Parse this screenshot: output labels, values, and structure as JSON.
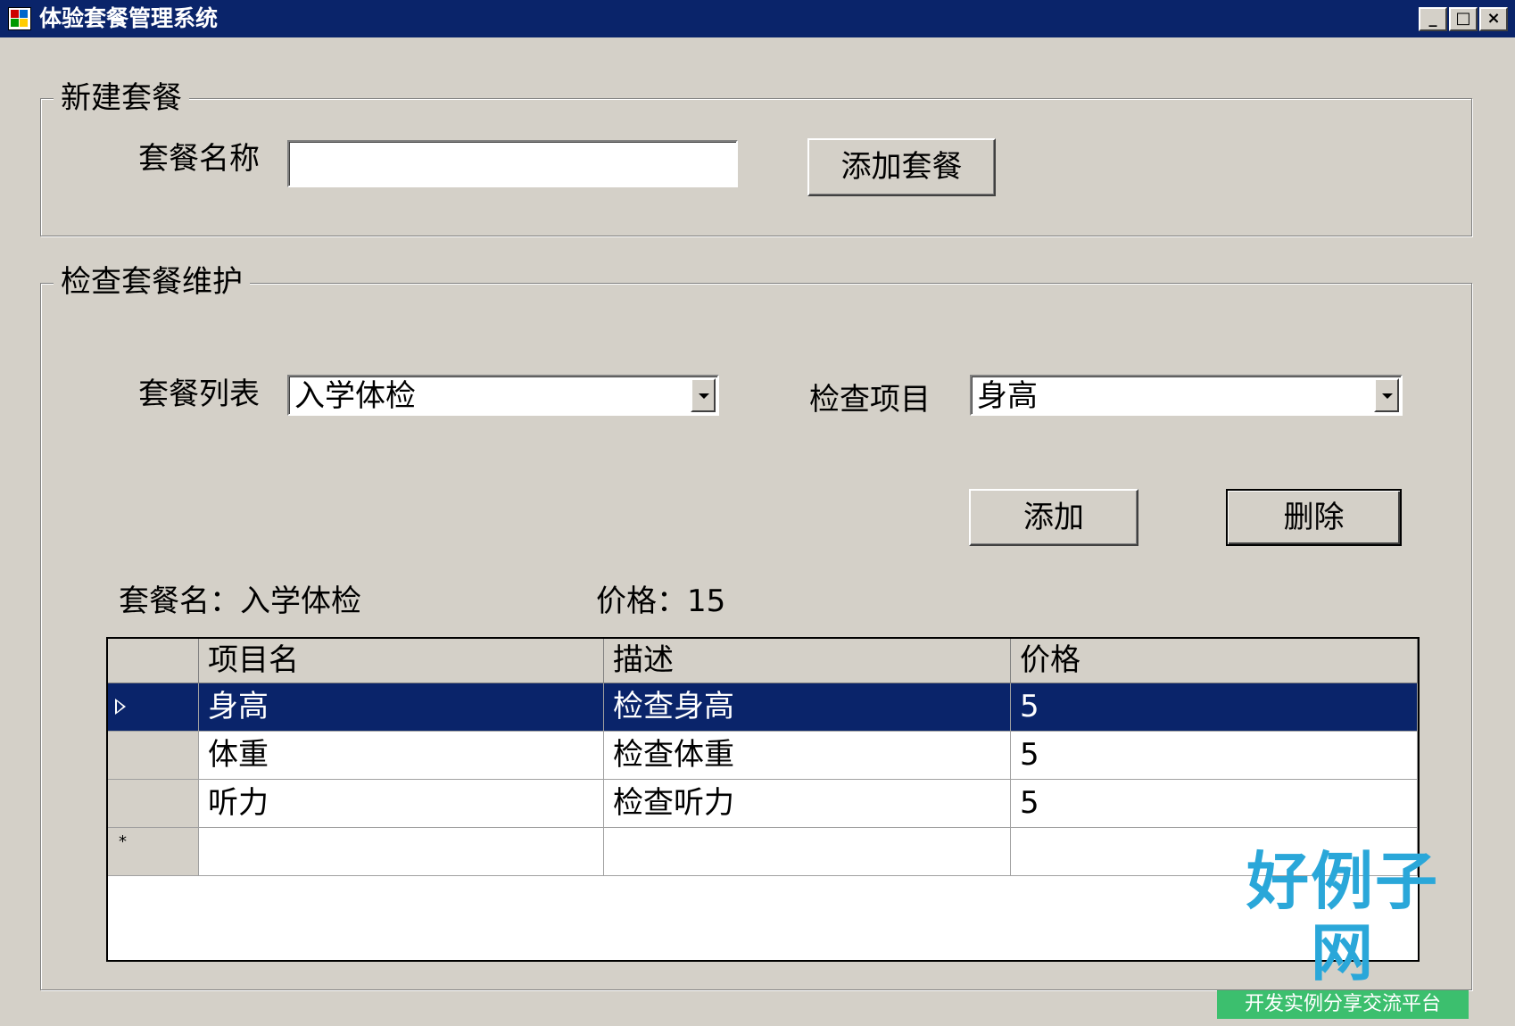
{
  "window": {
    "title": "体验套餐管理系统",
    "controls": [
      "_",
      "□",
      "×"
    ]
  },
  "new_package": {
    "legend": "新建套餐",
    "name_label": "套餐名称",
    "name_value": "",
    "add_button": "添加套餐"
  },
  "maintenance": {
    "legend": "检查套餐维护",
    "package_list_label": "套餐列表",
    "package_list_selected": "入学体检",
    "item_label": "检查项目",
    "item_selected": "身高",
    "add_button": "添加",
    "delete_button": "删除",
    "package_name_text": "套餐名：入学体检",
    "price_text": "价格：15"
  },
  "grid": {
    "columns": [
      "项目名",
      "描述",
      "价格"
    ],
    "rows": [
      {
        "name": "身高",
        "desc": "检查身高",
        "price": "5",
        "selected": true
      },
      {
        "name": "体重",
        "desc": "检查体重",
        "price": "5",
        "selected": false
      },
      {
        "name": "听力",
        "desc": "检查听力",
        "price": "5",
        "selected": false
      }
    ],
    "new_row_marker": "*"
  },
  "watermark": {
    "brand": "好例子网",
    "slogan": "开发实例分享交流平台"
  },
  "colors": {
    "titlebar": "#0a246a",
    "face": "#d4d0c8",
    "selection": "#0a246a"
  }
}
